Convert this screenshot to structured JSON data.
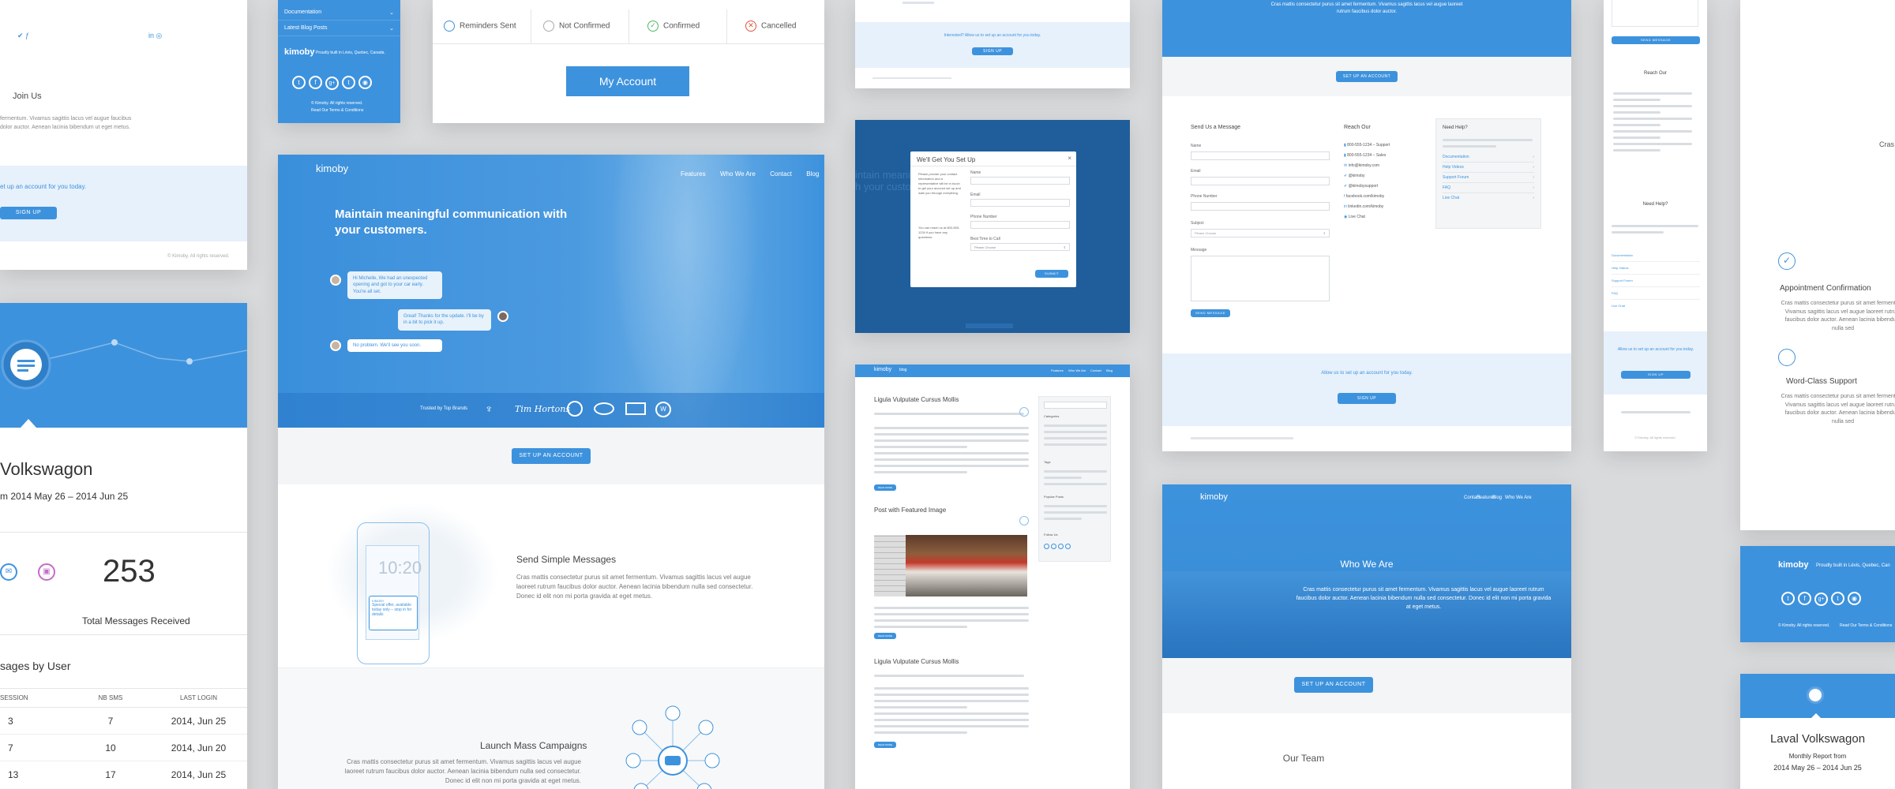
{
  "left_top": {
    "join_title": "Join Us",
    "join_text": "fermentum. Vivamus sagittis lacus vel augue faucibus dolor auctor. Aenean lacinia bibendum ut eget metus.",
    "signup_prompt": "et up an account for you today.",
    "signup_button": "SIGN UP",
    "copyright": "© Kimoby. All rights reserved."
  },
  "left_report": {
    "title": "Volkswagon",
    "period": "m 2014 May 26 – 2014 Jun 25",
    "stat_value": "253",
    "stat_label": "Total Messages Received",
    "table_title": "sages by User",
    "columns": [
      "SESSION",
      "NB SMS",
      "LAST LOGIN"
    ],
    "rows": [
      {
        "session": "3",
        "sms": "7",
        "login": "2014, Jun 25"
      },
      {
        "session": "7",
        "sms": "10",
        "login": "2014, Jun 20"
      },
      {
        "session": "13",
        "sms": "17",
        "login": "2014, Jun 25"
      }
    ]
  },
  "footer_card": {
    "menu": [
      "Documentation",
      "Latest Blog Posts"
    ],
    "brand": "kimoby",
    "tagline": "Proudly built in Lévis, Quebec, Canada.",
    "rights": "© Kimoby. All rights reserved.",
    "terms": "Read Our Terms & Conditions"
  },
  "account_card": {
    "statuses": [
      "Reminders Sent",
      "Not Confirmed",
      "Confirmed",
      "Cancelled"
    ],
    "button": "My Account"
  },
  "hero": {
    "brand": "kimoby",
    "nav": [
      "Features",
      "Who We Are",
      "Contact",
      "Blog"
    ],
    "headline": "Maintain meaningful communication with your customers.",
    "messages": [
      "Hi Michelle, We had an unexpected opening and got to your car early. You're all set.",
      "Great! Thanks for the update. I'll be by in a bit to pick it up.",
      "No problem. We'll see you soon."
    ],
    "trusted": "Trusted by Top Brands",
    "brands": [
      "Tim Hortons"
    ],
    "cta": "SET UP AN ACCOUNT",
    "phone_time": "10:20",
    "sms_from": "KIMOBY",
    "sms_text": "Special offer, available today only – stop in for details",
    "feature1_title": "Send Simple Messages",
    "feature1_text": "Cras mattis consectetur purus sit amet fermentum. Vivamus sagittis lacus vel augue laoreet rutrum faucibus dolor auctor. Aenean lacinia bibendum nulla sed consectetur. Donec id elit non mi porta gravida at eget metus.",
    "feature2_title": "Launch Mass Campaigns",
    "feature2_text": "Cras mattis consectetur purus sit amet fermentum. Vivamus sagittis lacus vel augue laoreet rutrum faucibus dolor auctor. Aenean lacinia bibendum nulla sed consectetur. Donec id elit non mi porta gravida at eget metus."
  },
  "mini_signup": {
    "prompt": "Interested? Allow us to set up an account for you today.",
    "button": "SIGN UP"
  },
  "modal": {
    "title": "We'll Get You Set Up",
    "intro": "Please provide your contact information and a representative will be in touch to get your account set up and walk you through everything.",
    "call": "You can reach us at 800-555-1234 if you have any questions.",
    "fields": [
      "Name",
      "Email",
      "Phone Number",
      "Best Time to Call"
    ],
    "select_placeholder": "Please Choose",
    "submit": "SUBMIT"
  },
  "blog": {
    "brand": "kimoby",
    "section": "blog",
    "nav": [
      "Features",
      "Who We Are",
      "Contact",
      "Blog"
    ],
    "posts": [
      "Ligula Vulputate Cursus Mollis",
      "Post with Featured Image",
      "Ligula Vulputate Cursus Mollis"
    ],
    "sidebar": [
      "Categories",
      "Tags",
      "Popular Posts",
      "Follow Us"
    ],
    "read_more": "READ MORE"
  },
  "contact": {
    "cta": "SET UP AN ACCOUNT",
    "form_title": "Send Us a Message",
    "labels": [
      "Name",
      "Email",
      "Phone Number",
      "Subject",
      "Message"
    ],
    "subject_placeholder": "Please Choose",
    "send": "SEND MESSAGE",
    "reach_title": "Reach Our",
    "reach": [
      "800-555-1234 – Support",
      "800-555-1234 – Sales",
      "info@kimoby.com",
      "@kimoby",
      "@kimobysupport",
      "facebook.com/kimoby",
      "linkedin.com/kimoby",
      "Live Chat"
    ],
    "help_title": "Need Help?",
    "help": [
      "Documentation",
      "Help Videos",
      "Support Forum",
      "FAQ",
      "Live Chat"
    ],
    "signup_prompt": "Allow us to set up an account for you today.",
    "signup_button": "SIGN UP"
  },
  "mobile_contact": {
    "send": "SEND MESSAGE",
    "reach_title": "Reach Our",
    "help_title": "Need Help?",
    "signup_prompt": "Allow us to set up an account for you today.",
    "signup_button": "SIGN UP",
    "rights": "© Kimoby. All rights reserved."
  },
  "about": {
    "brand": "kimoby",
    "nav": [
      "Features",
      "Who We Are",
      "Contact",
      "Blog"
    ],
    "title": "Who We Are",
    "text": "Cras mattis consectetur purus sit amet fermentum. Vivamus sagittis lacus vel augue laoreet rutrum faucibus dolor auctor. Aenean lacinia bibendum nulla sed consectetur. Donec id elit non mi porta gravida at eget metus.",
    "cta": "SET UP AN ACCOUNT",
    "team": "Our Team"
  },
  "right_features": {
    "clip": "Cras",
    "f1_title": "Appointment Confirmation",
    "f1_text": "Cras mattis consectetur purus sit amet fermentum. Vivamus sagittis lacus vel augue laoreet rutrum faucibus dolor auctor. Aenean lacinia bibendum nulla sed",
    "f2_title": "Word-Class Support",
    "f2_text": "Cras mattis consectetur purus sit amet fermentum. Vivamus sagittis lacus vel augue laoreet rutrum faucibus dolor auctor. Aenean lacinia bibendum nulla sed"
  },
  "right_footer": {
    "brand": "kimoby",
    "tagline": "Proudly built in Lévis, Quebec, Can",
    "rights": "© Kimoby. All rights reserved.",
    "terms": "Read Our Terms & Conditions"
  },
  "right_report": {
    "title": "Laval Volkswagon",
    "subtitle": "Monthly Report from",
    "period": "2014 May 26 – 2014 Jun 25"
  },
  "colors": {
    "brand_blue": "#3d92dd",
    "dark_blue": "#2f7fc8",
    "light_band": "#e7f1fb"
  }
}
